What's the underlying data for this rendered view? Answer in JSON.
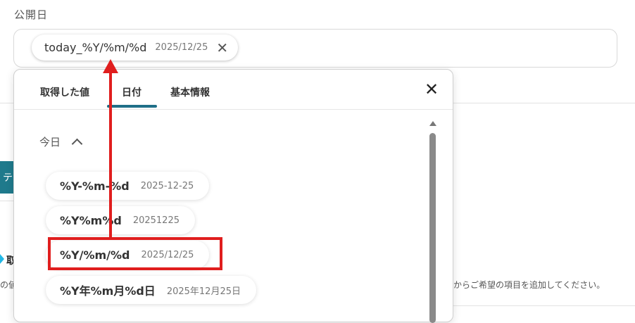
{
  "field": {
    "label": "公開日",
    "chip": {
      "token": "today_%Y/%m/%d",
      "value": "2025/12/25",
      "close_icon": "close-icon"
    }
  },
  "background": {
    "teal_button_text": "テ",
    "left_heading": "取",
    "left_text": "の値",
    "right_text": "からご希望の項目を追加してください。",
    "colors": {
      "teal": "#1f7a8c",
      "diamond": "#22b8e6"
    }
  },
  "panel": {
    "tabs": [
      {
        "label": "取得した値"
      },
      {
        "label": "日付",
        "active": true
      },
      {
        "label": "基本情報"
      }
    ],
    "close_icon": "close-icon",
    "section": {
      "title": "今日",
      "chevron_icon": "chevron-up-icon"
    },
    "options": [
      {
        "token": "%Y-%m-%d",
        "value": "2025-12-25"
      },
      {
        "token": "%Y%m%d",
        "value": "20251225"
      },
      {
        "token": "%Y/%m/%d",
        "value": "2025/12/25",
        "highlighted": true
      },
      {
        "token": "%Y年%m月%d日",
        "value": "2025年12月25日"
      }
    ],
    "accent_color": "#1f6f88"
  },
  "annotation": {
    "color": "#e01e1e"
  }
}
